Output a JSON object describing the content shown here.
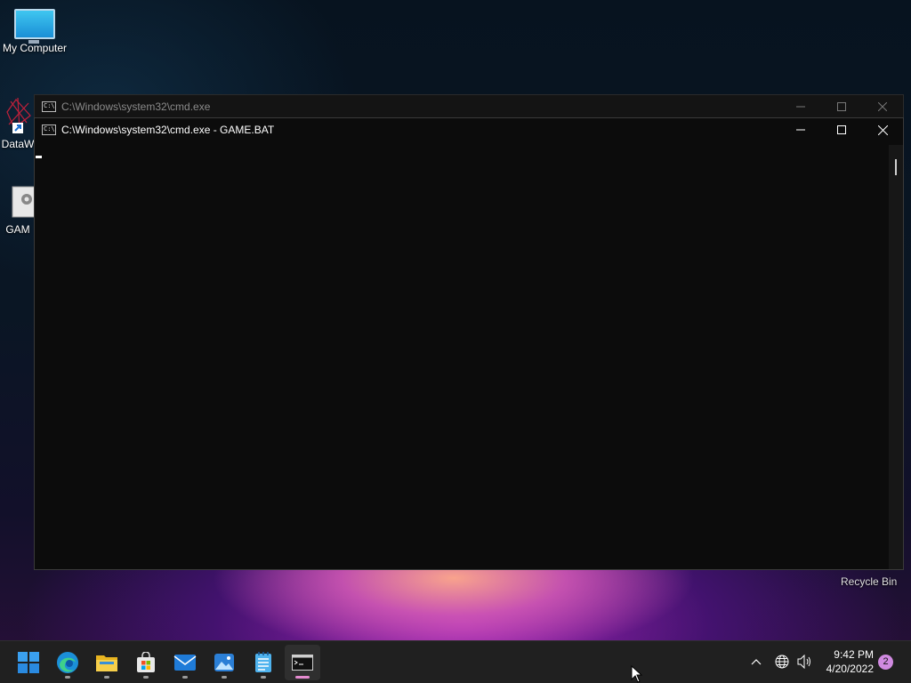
{
  "desktop": {
    "icons": [
      {
        "label": "My Computer"
      },
      {
        "label": "DataW"
      },
      {
        "label": "GAM"
      }
    ],
    "recycle_bin": "Recycle Bin"
  },
  "windows": {
    "back": {
      "title": "C:\\Windows\\system32\\cmd.exe"
    },
    "front": {
      "title": "C:\\Windows\\system32\\cmd.exe - GAME.BAT"
    }
  },
  "taskbar": {
    "apps": [
      {
        "name": "start-button"
      },
      {
        "name": "edge"
      },
      {
        "name": "file-explorer"
      },
      {
        "name": "microsoft-store"
      },
      {
        "name": "mail"
      },
      {
        "name": "photos"
      },
      {
        "name": "notepad"
      },
      {
        "name": "command-prompt"
      }
    ],
    "time": "9:42 PM",
    "date": "4/20/2022",
    "notification_count": "2",
    "accent": "#e58bd0"
  }
}
